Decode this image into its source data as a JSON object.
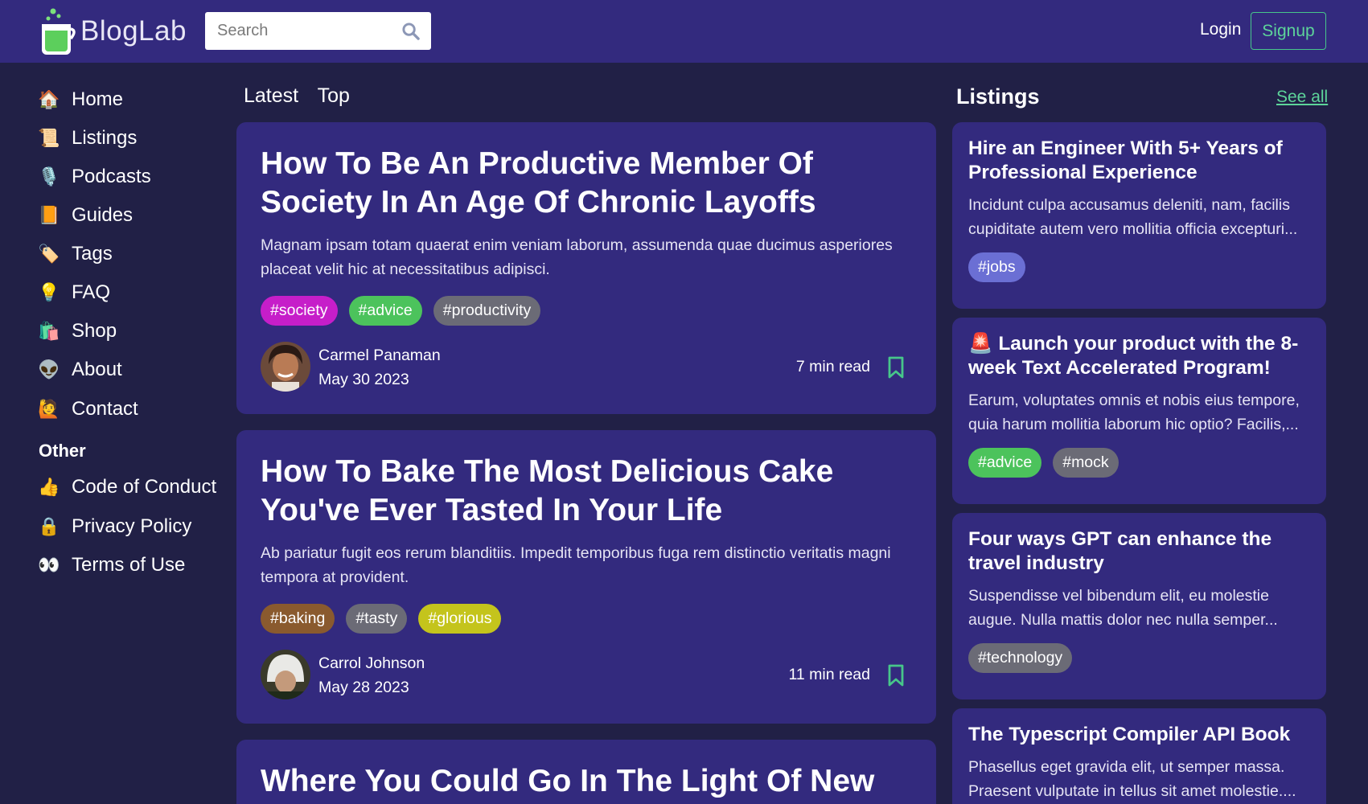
{
  "header": {
    "brand": "BlogLab",
    "search_placeholder": "Search",
    "login_label": "Login",
    "signup_label": "Signup"
  },
  "sidebar": {
    "items": [
      {
        "label": "Home",
        "emoji": "🏠",
        "icon": "house-icon"
      },
      {
        "label": "Listings",
        "emoji": "📜",
        "icon": "scroll-icon"
      },
      {
        "label": "Podcasts",
        "emoji": "🎙️",
        "icon": "microphone-icon"
      },
      {
        "label": "Guides",
        "emoji": "📙",
        "icon": "book-icon"
      },
      {
        "label": "Tags",
        "emoji": "🏷️",
        "icon": "tag-icon"
      },
      {
        "label": "FAQ",
        "emoji": "💡",
        "icon": "lightbulb-icon"
      },
      {
        "label": "Shop",
        "emoji": "🛍️",
        "icon": "shopping-bags-icon"
      },
      {
        "label": "About",
        "emoji": "👽",
        "icon": "alien-icon"
      },
      {
        "label": "Contact",
        "emoji": "🙋",
        "icon": "person-raising-hand-icon"
      }
    ],
    "other_heading": "Other",
    "other_items": [
      {
        "label": "Code of Conduct",
        "emoji": "👍",
        "icon": "thumbs-up-icon"
      },
      {
        "label": "Privacy Policy",
        "emoji": "🔒",
        "icon": "lock-icon"
      },
      {
        "label": "Terms of Use",
        "emoji": "👀",
        "icon": "eyes-icon"
      }
    ]
  },
  "feed": {
    "tabs": [
      "Latest",
      "Top"
    ],
    "posts": [
      {
        "title": "How To Be An Productive Member Of Society In An Age Of Chronic Layoffs",
        "description": "Magnam ipsam totam quaerat enim veniam laborum, assumenda quae ducimus asperiores placeat velit hic at necessitatibus adipisci.",
        "tags": [
          {
            "label": "#society",
            "color": "#c61ec9"
          },
          {
            "label": "#advice",
            "color": "#4cc35c"
          },
          {
            "label": "#productivity",
            "color": "#6b6b76"
          }
        ],
        "author": "Carmel Panaman",
        "date": "May 30 2023",
        "read_time": "7 min read"
      },
      {
        "title": "How To Bake The Most Delicious Cake You've Ever Tasted In Your Life",
        "description": "Ab pariatur fugit eos rerum blanditiis. Impedit temporibus fuga rem distinctio veritatis magni tempora at provident.",
        "tags": [
          {
            "label": "#baking",
            "color": "#8a5a2e"
          },
          {
            "label": "#tasty",
            "color": "#6b6b76"
          },
          {
            "label": "#glorious",
            "color": "#c4c41c"
          }
        ],
        "author": "Carrol Johnson",
        "date": "May 28 2023",
        "read_time": "11 min read"
      },
      {
        "title": "Where You Could Go In The Light Of New"
      }
    ]
  },
  "listings": {
    "title": "Listings",
    "see_all": "See all",
    "items": [
      {
        "title": "Hire an Engineer With 5+ Years of Professional Experience",
        "description": "Incidunt culpa accusamus deleniti, nam, facilis cupiditate autem vero mollitia officia excepturi...",
        "tags": [
          {
            "label": "#jobs",
            "color": "#6b6fd4"
          }
        ]
      },
      {
        "emoji": "🚨",
        "title": "Launch your product with the 8-week Text Accelerated Program!",
        "description": "Earum, voluptates omnis et nobis eius tempore, quia harum mollitia laborum hic optio? Facilis,...",
        "tags": [
          {
            "label": "#advice",
            "color": "#4cc35c"
          },
          {
            "label": "#mock",
            "color": "#6b6b76"
          }
        ]
      },
      {
        "title": "Four ways GPT can enhance the travel industry",
        "description": "Suspendisse vel bibendum elit, eu molestie augue. Nulla mattis dolor nec nulla semper...",
        "tags": [
          {
            "label": "#technology",
            "color": "#6b6b76"
          }
        ]
      },
      {
        "title": "The Typescript Compiler API Book",
        "description": "Phasellus eget gravida elit, ut semper massa. Praesent vulputate in tellus sit amet molestie....",
        "tags": []
      }
    ]
  },
  "colors": {
    "background": "#212046",
    "header": "#332a7e",
    "card": "#332a7e",
    "accent_green": "#5dd49a"
  }
}
